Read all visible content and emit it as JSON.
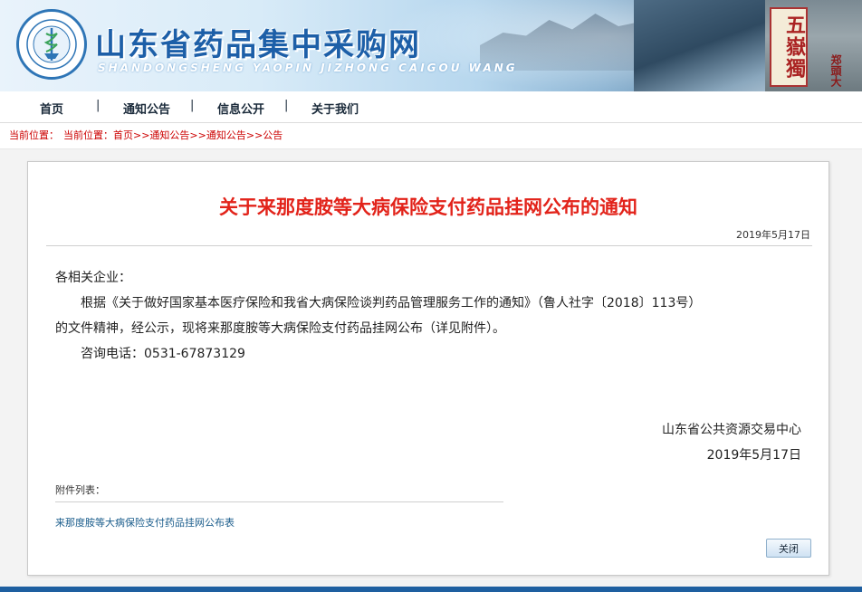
{
  "banner": {
    "site_title": "山东省药品集中采购网",
    "site_subtitle": "SHANDONGSHENG YAOPIN JIZHONG CAIGOU WANG",
    "seal_text": "五嶽獨",
    "seal_small_text": "郑頭大",
    "logo_icon": "caduceus-emblem-icon"
  },
  "nav": {
    "items": [
      {
        "label": "首页"
      },
      {
        "label": "通知公告"
      },
      {
        "label": "信息公开"
      },
      {
        "label": "关于我们"
      }
    ],
    "separator": "|"
  },
  "breadcrumb": {
    "label": "当前位置：",
    "path": "当前位置：首页>>通知公告>>通知公告>>公告"
  },
  "article": {
    "title": "关于来那度胺等大病保险支付药品挂网公布的通知",
    "date": "2019年5月17日",
    "salutation": "各相关企业：",
    "para1_line1": "根据《关于做好国家基本医疗保险和我省大病保险谈判药品管理服务工作的通知》（鲁人社字〔2018〕113号）",
    "para1_line2": "的文件精神，经公示，现将来那度胺等大病保险支付药品挂网公布（详见附件）。",
    "contact": "咨询电话：0531-67873129",
    "signature_org": "山东省公共资源交易中心",
    "signature_date": "2019年5月17日"
  },
  "attachments": {
    "label": "附件列表：",
    "items": [
      {
        "name": "来那度胺等大病保险支付药品挂网公布表"
      }
    ]
  },
  "buttons": {
    "close_label": "关闭"
  },
  "colors": {
    "title_red": "#e2231a",
    "brand_blue": "#1d5fa8",
    "link_blue": "#1b5d8c"
  }
}
